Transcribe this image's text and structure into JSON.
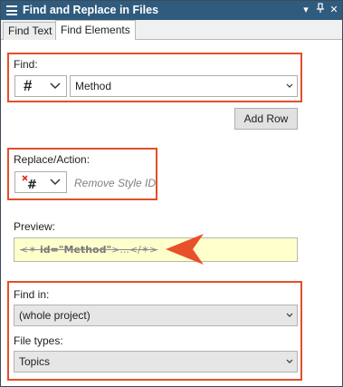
{
  "window": {
    "title": "Find and Replace in Files",
    "pin_glyph": "⊥",
    "close_glyph": "✕",
    "dropdown_glyph": "▾"
  },
  "tabs": [
    {
      "label": "Find Text",
      "active": false
    },
    {
      "label": "Find Elements",
      "active": true
    }
  ],
  "find": {
    "label": "Find:",
    "type_icon": "#",
    "element_value": "Method",
    "add_row_label": "Add Row"
  },
  "replace": {
    "label": "Replace/Action:",
    "action_icon": "remove-style-id-icon",
    "action_text": "Remove Style ID"
  },
  "preview": {
    "label": "Preview:",
    "prefix": "<✶ ",
    "attr": "id=\"Method\"",
    "suffix": ">...</✶>"
  },
  "scope": {
    "find_in_label": "Find in:",
    "find_in_value": "(whole project)",
    "file_types_label": "File types:",
    "file_types_value": "Topics"
  },
  "colors": {
    "title_bar": "#2f5b7e",
    "highlight_border": "#e0502a",
    "arrow": "#e8502a",
    "preview_bg": "#ffffcc"
  }
}
